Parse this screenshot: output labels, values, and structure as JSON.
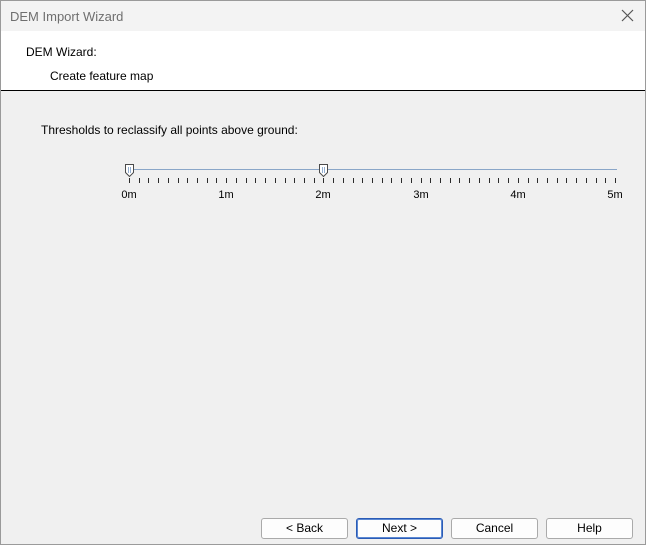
{
  "window": {
    "title": "DEM Import Wizard"
  },
  "header": {
    "title": "DEM Wizard:",
    "subtitle": "Create feature map"
  },
  "main": {
    "threshold_label": "Thresholds to reclassify all points above ground:",
    "slider": {
      "min": 0,
      "max": 5,
      "unit": "m",
      "thumb_values": [
        0,
        2
      ],
      "tick_labels": [
        "0m",
        "1m",
        "2m",
        "3m",
        "4m",
        "5m"
      ],
      "minor_ticks_per_unit": 10
    }
  },
  "buttons": {
    "back": "< Back",
    "next": "Next >",
    "cancel": "Cancel",
    "help": "Help"
  },
  "colors": {
    "track": "#8aa6c8",
    "default_button_border": "#2a5bb6"
  },
  "icons": {
    "close": "close-icon",
    "thumb": "slider-thumb-icon"
  }
}
